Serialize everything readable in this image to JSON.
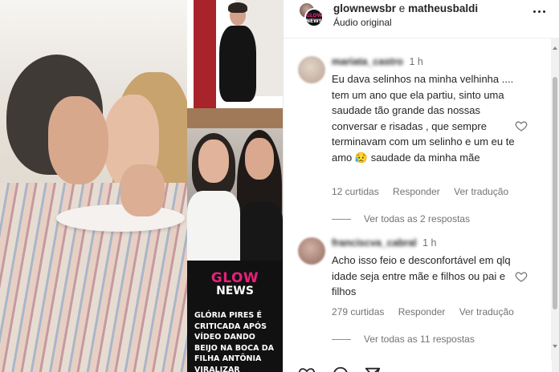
{
  "post": {
    "headline": "GLÓRIA PIRES É CRITICADA APÓS VÍDEO DANDO BEIJO NA BOCA DA FILHA ANTÔNIA VIRALIZAR",
    "brand_top": "GLOW",
    "brand_bottom": "NEWS"
  },
  "header": {
    "user_a": "glownewsbr",
    "conjunction": "e",
    "user_b": "matheusbaldi",
    "audio": "Áudio original",
    "avatar_small_top": "GLOW",
    "avatar_small_bottom": "NEWS"
  },
  "comments": [
    {
      "username": "mariata_castro",
      "time": "1 h",
      "text": "Eu dava selinhos na minha velhinha .... tem um ano que ela partiu, sinto uma saudade tão grande das nossas conversar e risadas , que sempre terminavam com um selinho e um eu te amo 😥 saudade da minha mãe",
      "likes": "12 curtidas",
      "reply_label": "Responder",
      "translate_label": "Ver tradução",
      "view_replies": "Ver todas as 2 respostas"
    },
    {
      "username": "franciscva_cabral",
      "time": "1 h",
      "text": "Acho isso feio e desconfortável em qlq idade seja entre mãe e filhos ou pai e filhos",
      "likes": "279 curtidas",
      "reply_label": "Responder",
      "translate_label": "Ver tradução",
      "view_replies": "Ver todas as 11 respostas"
    }
  ],
  "colors": {
    "brand_pink": "#e8207a",
    "text_primary": "#262626",
    "text_secondary": "#737373"
  },
  "icons": [
    "more-options-icon",
    "heart-icon",
    "comment-icon",
    "share-icon",
    "like-icon"
  ]
}
